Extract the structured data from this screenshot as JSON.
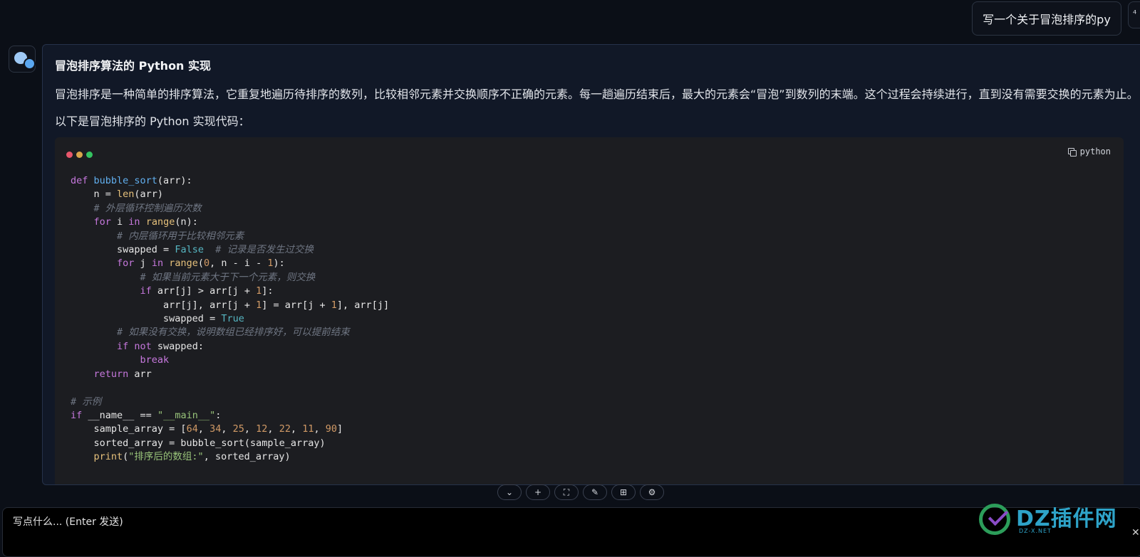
{
  "user_message": "写一个关于冒泡排序的py",
  "user_edge_glyph": "⁴",
  "assistant": {
    "title": "冒泡排序算法的 Python 实现",
    "paragraph1": "冒泡排序是一种简单的排序算法，它重复地遍历待排序的数列，比较相邻元素并交换顺序不正确的元素。每一趟遍历结束后，最大的元素会“冒泡”到数列的末端。这个过程会持续进行，直到没有需要交换的元素为止。",
    "paragraph2": "以下是冒泡排序的 Python 实现代码：",
    "code_language": "python",
    "code_lines": [
      [
        [
          "kw",
          "def "
        ],
        [
          "fn",
          "bubble_sort"
        ],
        [
          "",
          "(arr):"
        ]
      ],
      [
        [
          "",
          "    n = "
        ],
        [
          "bi",
          "len"
        ],
        [
          "",
          "(arr)"
        ]
      ],
      [
        [
          "cm",
          "    # 外层循环控制遍历次数"
        ]
      ],
      [
        [
          "kw",
          "    for "
        ],
        [
          "",
          "i "
        ],
        [
          "kw",
          "in "
        ],
        [
          "bi",
          "range"
        ],
        [
          "",
          "(n):"
        ]
      ],
      [
        [
          "cm",
          "        # 内层循环用于比较相邻元素"
        ]
      ],
      [
        [
          "",
          "        swapped = "
        ],
        [
          "bo",
          "False"
        ],
        [
          "cm",
          "  # 记录是否发生过交换"
        ]
      ],
      [
        [
          "kw",
          "        for "
        ],
        [
          "",
          "j "
        ],
        [
          "kw",
          "in "
        ],
        [
          "bi",
          "range"
        ],
        [
          "",
          "("
        ],
        [
          "nm",
          "0"
        ],
        [
          "",
          ", n - i - "
        ],
        [
          "nm",
          "1"
        ],
        [
          "",
          "):"
        ]
      ],
      [
        [
          "cm",
          "            # 如果当前元素大于下一个元素，则交换"
        ]
      ],
      [
        [
          "kw",
          "            if "
        ],
        [
          "",
          "arr[j] > arr[j + "
        ],
        [
          "nm",
          "1"
        ],
        [
          "",
          "]:"
        ]
      ],
      [
        [
          "",
          "                arr[j], arr[j + "
        ],
        [
          "nm",
          "1"
        ],
        [
          "",
          "] = arr[j + "
        ],
        [
          "nm",
          "1"
        ],
        [
          "",
          "], arr[j]"
        ]
      ],
      [
        [
          "",
          "                swapped = "
        ],
        [
          "bo",
          "True"
        ]
      ],
      [
        [
          "cm",
          "        # 如果没有交换，说明数组已经排序好，可以提前结束"
        ]
      ],
      [
        [
          "kw",
          "        if not "
        ],
        [
          "",
          "swapped:"
        ]
      ],
      [
        [
          "kw",
          "            break"
        ]
      ],
      [
        [
          "kw",
          "    return "
        ],
        [
          "",
          "arr"
        ]
      ],
      [
        [
          "",
          ""
        ]
      ],
      [
        [
          "cm",
          "# 示例"
        ]
      ],
      [
        [
          "kw",
          "if "
        ],
        [
          "",
          "__name__ == "
        ],
        [
          "st",
          "\"__main__\""
        ],
        [
          "",
          ":"
        ]
      ],
      [
        [
          "",
          "    sample_array = ["
        ],
        [
          "nm",
          "64"
        ],
        [
          "",
          ", "
        ],
        [
          "nm",
          "34"
        ],
        [
          "",
          ", "
        ],
        [
          "nm",
          "25"
        ],
        [
          "",
          ", "
        ],
        [
          "nm",
          "12"
        ],
        [
          "",
          ", "
        ],
        [
          "nm",
          "22"
        ],
        [
          "",
          ", "
        ],
        [
          "nm",
          "11"
        ],
        [
          "",
          ", "
        ],
        [
          "nm",
          "90"
        ],
        [
          "",
          "]"
        ]
      ],
      [
        [
          "",
          "    sorted_array = bubble_sort(sample_array)"
        ]
      ],
      [
        [
          "bi",
          "    print"
        ],
        [
          "",
          "("
        ],
        [
          "st",
          "\"排序后的数组:\""
        ],
        [
          "",
          ", sorted_array)"
        ]
      ]
    ]
  },
  "toolbar": [
    {
      "name": "scroll-bottom-button",
      "icon": "double-chevron-down-icon",
      "glyph": "⌄"
    },
    {
      "name": "new-chat-button",
      "icon": "plus-icon",
      "glyph": "+"
    },
    {
      "name": "fullscreen-button",
      "icon": "fullscreen-icon",
      "glyph": "⛶"
    },
    {
      "name": "magic-wand-button",
      "icon": "magic-wand-icon",
      "glyph": "✎"
    },
    {
      "name": "plugins-button",
      "icon": "plugin-icon",
      "glyph": "⊞"
    },
    {
      "name": "settings-button",
      "icon": "gear-icon",
      "glyph": "⚙"
    }
  ],
  "input": {
    "placeholder": "写点什么... (Enter 发送)"
  },
  "watermark": {
    "text": "DZ插件网",
    "subtext": "DZ-X.NET"
  },
  "edge_close_glyph": "✕"
}
